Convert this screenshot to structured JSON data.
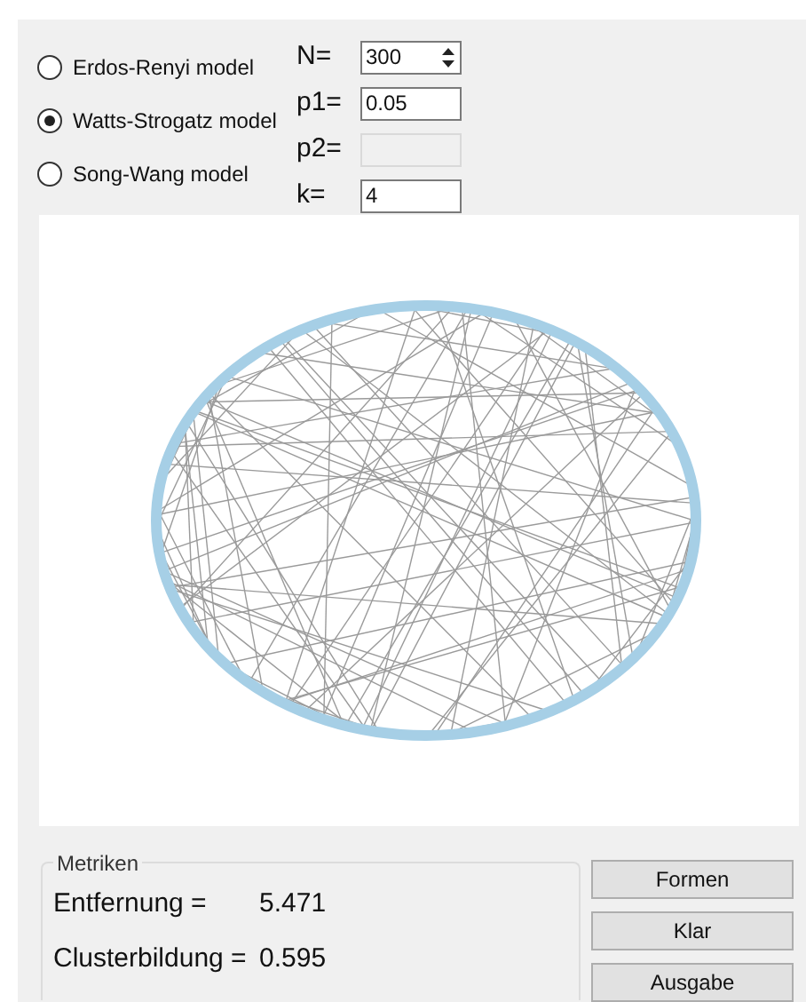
{
  "models": [
    {
      "label": "Erdos-Renyi model",
      "selected": false
    },
    {
      "label": "Watts-Strogatz model",
      "selected": true
    },
    {
      "label": "Song-Wang model",
      "selected": false
    }
  ],
  "parameters": [
    {
      "label": "N=",
      "kind": "spinner",
      "value": "300",
      "disabled": false
    },
    {
      "label": "p1=",
      "kind": "text",
      "value": "0.05",
      "disabled": false
    },
    {
      "label": "p2=",
      "kind": "text",
      "disabled": true
    },
    {
      "label": "k=",
      "kind": "text",
      "value": "4",
      "disabled": false
    }
  ],
  "metrics": {
    "title": "Metriken",
    "rows": [
      {
        "label": "Entfernung =",
        "value": "5.471"
      },
      {
        "label": "Clusterbildung =",
        "value": "0.595"
      }
    ]
  },
  "buttons": [
    "Formen",
    "Klar",
    "Ausgabe"
  ]
}
